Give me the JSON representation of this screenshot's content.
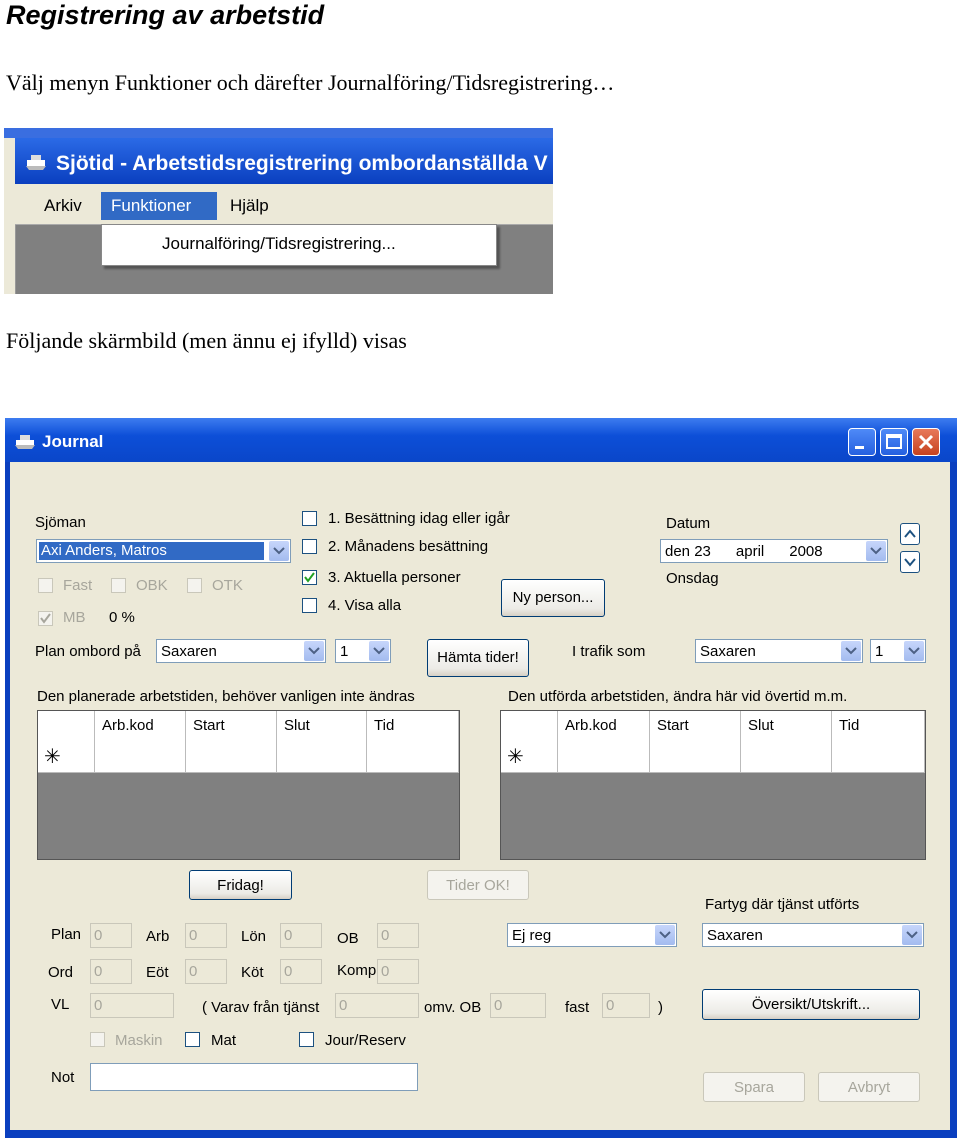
{
  "doc": {
    "title": "Registrering av arbetstid",
    "intro": "Välj menyn Funktioner och därefter Journalföring/Tidsregistrering…",
    "caption": "Följande skärmbild (men ännu ej ifylld) visas"
  },
  "shot1": {
    "window_title": "Sjötid - Arbetstidsregistrering ombordanställda V",
    "menu": [
      "Arkiv",
      "Funktioner",
      "Hjälp"
    ],
    "dropdown_item": "Journalföring/Tidsregistrering..."
  },
  "journal": {
    "title": "Journal",
    "sjoman_label": "Sjöman",
    "sjoman_value": "Axi Anders, Matros",
    "fast_label": "Fast",
    "obk_label": "OBK",
    "otk_label": "OTK",
    "mb_label": "MB",
    "mb_percent": "0 %",
    "options": [
      {
        "label": "1. Besättning idag eller igår",
        "checked": false
      },
      {
        "label": "2. Månadens besättning",
        "checked": false
      },
      {
        "label": "3. Aktuella personer",
        "checked": true
      },
      {
        "label": "4. Visa alla",
        "checked": false
      }
    ],
    "ny_person": "Ny person...",
    "datum_label": "Datum",
    "datum_value": "den 23      april      2008",
    "weekday": "Onsdag",
    "plan_ombord_label": "Plan ombord på",
    "plan_ombord_ship": "Saxaren",
    "plan_ombord_num": "1",
    "hamta_tider": "Hämta tider!",
    "i_trafik_label": "I trafik som",
    "i_trafik_ship": "Saxaren",
    "i_trafik_num": "1",
    "planned_header": "Den planerade arbetstiden, behöver vanligen inte ändras",
    "done_header": "Den utförda arbetstiden, ändra här vid övertid m.m.",
    "grid_columns": [
      "Arb.kod",
      "Start",
      "Slut",
      "Tid"
    ],
    "new_row_marker": "✳",
    "fridag": "Fridag!",
    "tider_ok": "Tider OK!",
    "fartyg_label": "Fartyg där tjänst utförts",
    "fartyg_value": "Saxaren",
    "ej_reg": "Ej reg",
    "fields": {
      "plan_label": "Plan",
      "plan": "0",
      "arb_label": "Arb",
      "arb": "0",
      "lon_label": "Lön",
      "lon": "0",
      "ob_label": "OB",
      "ob": "0",
      "ord_label": "Ord",
      "ord": "0",
      "eot_label": "Eöt",
      "eot": "0",
      "kot_label": "Köt",
      "kot": "0",
      "komp_label": "Komp",
      "komp": "0",
      "vl_label": "VL",
      "vl": "0",
      "varav_label": "( Varav från tjänst",
      "varav": "0",
      "omv_ob_label": "omv. OB",
      "omv_ob": "0",
      "fast_label": "fast",
      "fast": "0",
      "close_paren": ")"
    },
    "oversikt": "Översikt/Utskrift...",
    "maskin_label": "Maskin",
    "mat_label": "Mat",
    "jour_label": "Jour/Reserv",
    "not_label": "Not",
    "spara": "Spara",
    "avbryt": "Avbryt"
  }
}
